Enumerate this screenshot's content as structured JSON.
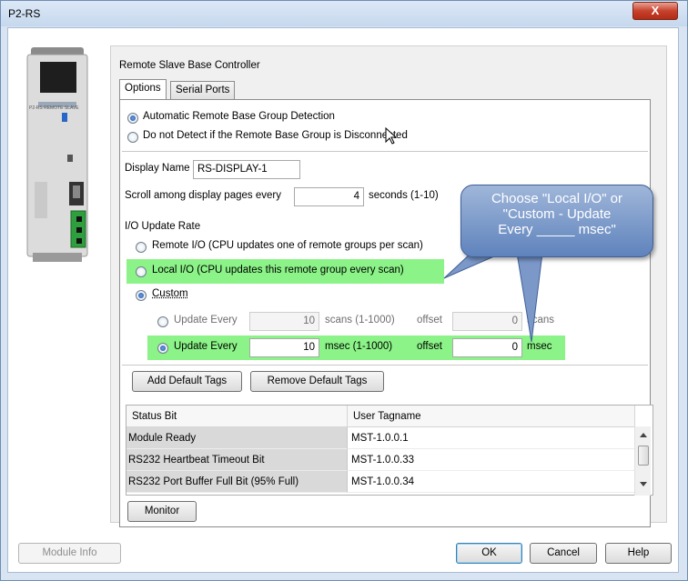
{
  "window": {
    "title": "P2-RS",
    "close_symbol": "X"
  },
  "device": {
    "label": "P2-RS REMOTE SLAVE"
  },
  "group_title": "Remote Slave Base Controller",
  "tabs": [
    {
      "label": "Options"
    },
    {
      "label": "Serial Ports"
    }
  ],
  "detection": {
    "auto_label": "Automatic Remote Base Group Detection",
    "nodetect_label": "Do not Detect if the Remote Base Group is Disconnected"
  },
  "display_name": {
    "label": "Display Name",
    "value": "RS-DISPLAY-1"
  },
  "scroll": {
    "label": "Scroll among display pages every",
    "value": "4",
    "suffix": "seconds (1-10)"
  },
  "io_update": {
    "heading": "I/O Update Rate",
    "remote_label": "Remote I/O (CPU updates one of remote groups per scan)",
    "local_label": "Local I/O (CPU updates this remote group every scan)",
    "custom_label": "Custom",
    "scans_row": {
      "label": "Update Every",
      "value": "10",
      "unit": "scans (1-1000)",
      "offset_label": "offset",
      "offset_value": "0",
      "offset_unit": "scans"
    },
    "msec_row": {
      "label": "Update Every",
      "value": "10",
      "unit": "msec (1-1000)",
      "offset_label": "offset",
      "offset_value": "0",
      "offset_unit": "msec"
    }
  },
  "buttons": {
    "add_default_tags": "Add Default Tags",
    "remove_default_tags": "Remove Default Tags",
    "monitor": "Monitor",
    "module_info": "Module Info",
    "ok": "OK",
    "cancel": "Cancel",
    "help": "Help"
  },
  "table": {
    "columns": [
      "Status Bit",
      "User Tagname"
    ],
    "rows": [
      [
        "Module Ready",
        "MST-1.0.0.1"
      ],
      [
        "RS232 Heartbeat Timeout Bit",
        "MST-1.0.0.33"
      ],
      [
        "RS232 Port Buffer Full Bit (95% Full)",
        "MST-1.0.0.34"
      ]
    ]
  },
  "callout": {
    "lines": [
      "Choose \"Local I/O\" or",
      "\"Custom - Update",
      "Every _____ msec\""
    ]
  },
  "colors": {
    "highlight": "#7ef27a",
    "callout": "#6f8fc7",
    "selected_radio": "#1d4fa3"
  }
}
